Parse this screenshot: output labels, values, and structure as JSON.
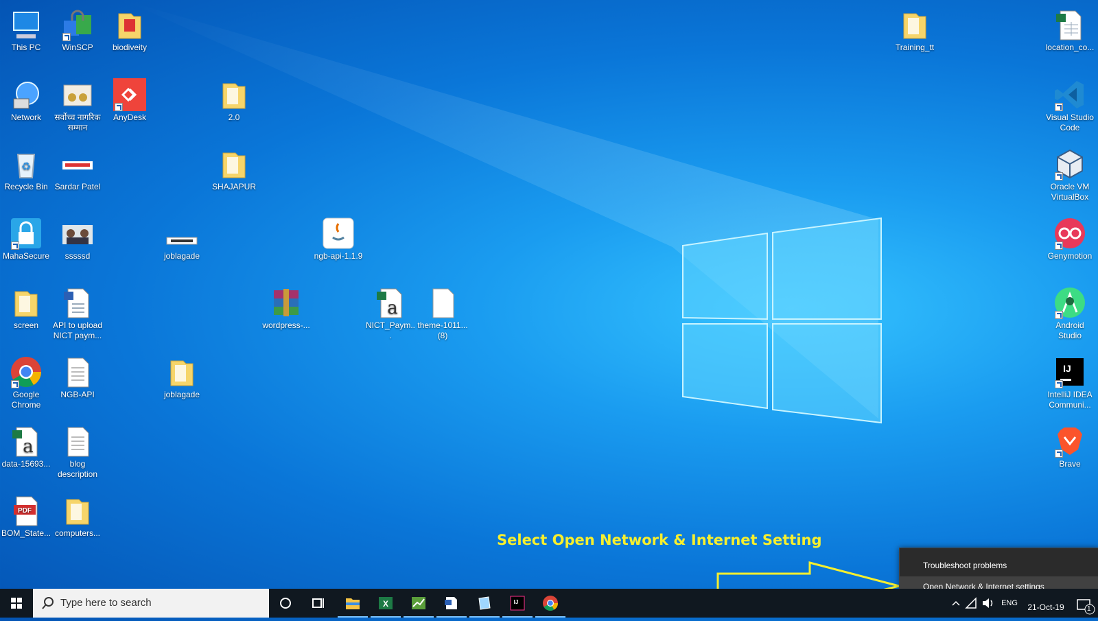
{
  "desktop_icons": [
    {
      "label": "This PC",
      "icon": "this-pc-icon"
    },
    {
      "label": "WinSCP",
      "icon": "winscp-icon"
    },
    {
      "label": "biodiveity",
      "icon": "folder-icon"
    },
    {
      "label": "Network",
      "icon": "network-icon"
    },
    {
      "label": "सर्वोच्च नागरिक सम्मान",
      "icon": "image-icon"
    },
    {
      "label": "AnyDesk",
      "icon": "anydesk-icon"
    },
    {
      "label": "2.0",
      "icon": "folder-icon"
    },
    {
      "label": "Recycle Bin",
      "icon": "recycle-bin-icon"
    },
    {
      "label": "Sardar Patel",
      "icon": "image-icon"
    },
    {
      "label": "SHAJAPUR",
      "icon": "folder-icon"
    },
    {
      "label": "MahaSecure",
      "icon": "mahasecure-icon"
    },
    {
      "label": "sssssd",
      "icon": "image-icon"
    },
    {
      "label": "joblagade",
      "icon": "image-icon"
    },
    {
      "label": "ngb-api-1.1.9",
      "icon": "java-icon"
    },
    {
      "label": "screen",
      "icon": "folder-icon"
    },
    {
      "label": "API to upload NICT paym...",
      "icon": "document-icon"
    },
    {
      "label": "wordpress-...",
      "icon": "winrar-icon"
    },
    {
      "label": "NICT_Paym...",
      "icon": "csv-icon"
    },
    {
      "label": "theme-1011... (8)",
      "icon": "file-icon"
    },
    {
      "label": "Google Chrome",
      "icon": "chrome-icon"
    },
    {
      "label": "NGB-API",
      "icon": "text-file-icon"
    },
    {
      "label": "joblagade",
      "icon": "folder-icon"
    },
    {
      "label": "data-15693...",
      "icon": "csv-icon"
    },
    {
      "label": "blog description",
      "icon": "text-file-icon"
    },
    {
      "label": "BOM_State...",
      "icon": "pdf-icon"
    },
    {
      "label": "computers...",
      "icon": "folder-icon"
    },
    {
      "label": "Training_tt",
      "icon": "folder-icon"
    },
    {
      "label": "location_co...",
      "icon": "excel-icon"
    },
    {
      "label": "Visual Studio Code",
      "icon": "vscode-icon"
    },
    {
      "label": "Oracle VM VirtualBox",
      "icon": "virtualbox-icon"
    },
    {
      "label": "Genymotion",
      "icon": "genymotion-icon"
    },
    {
      "label": "Android Studio",
      "icon": "android-studio-icon"
    },
    {
      "label": "IntelliJ IDEA Communi...",
      "icon": "intellij-icon"
    },
    {
      "label": "Brave",
      "icon": "brave-icon"
    }
  ],
  "instruction": "Select Open Network & Internet Setting",
  "context_menu": {
    "items": [
      "Troubleshoot problems",
      "Open Network & Internet settings"
    ]
  },
  "taskbar": {
    "search_placeholder": "Type here to search",
    "tray_lang": "ENG",
    "date": "21-Oct-19",
    "notification_count": "1"
  },
  "colors": {
    "annotation": "#f6ef2e",
    "taskbar": "#101820",
    "menu": "#2b2b2b"
  }
}
